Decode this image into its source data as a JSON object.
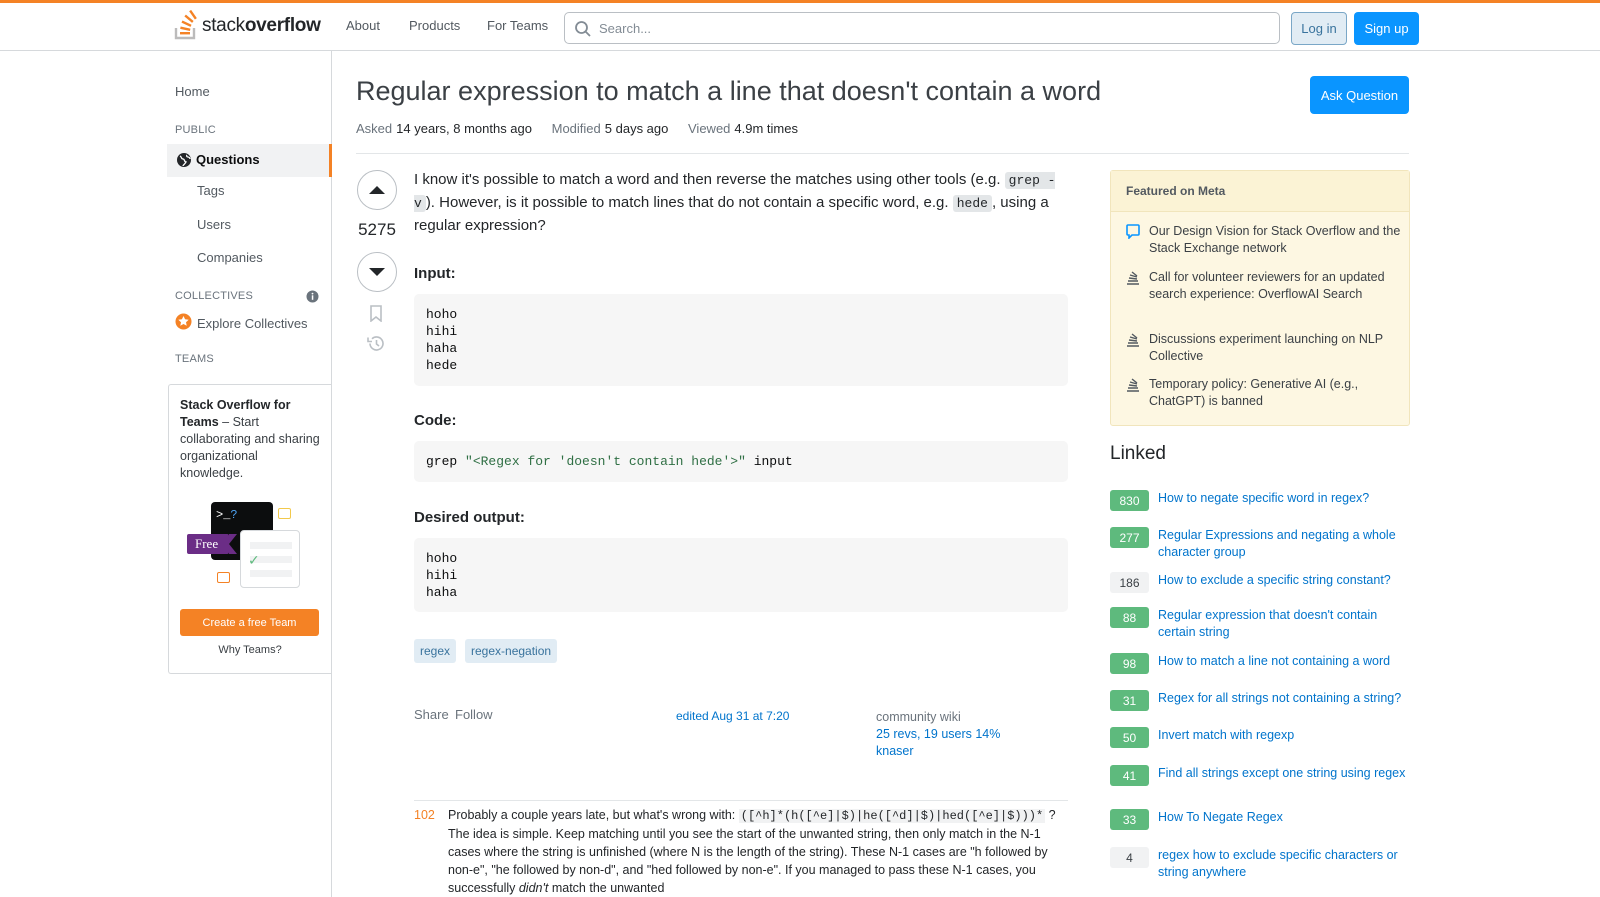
{
  "header": {
    "logo_light": "stack",
    "logo_bold": "overflow",
    "nav": [
      "About",
      "Products",
      "For Teams"
    ],
    "search_placeholder": "Search...",
    "login": "Log in",
    "signup": "Sign up"
  },
  "sidebar": {
    "home": "Home",
    "public_head": "PUBLIC",
    "questions": "Questions",
    "tags": "Tags",
    "users": "Users",
    "companies": "Companies",
    "collectives_head": "COLLECTIVES",
    "explore_collectives": "Explore Collectives",
    "teams_head": "TEAMS",
    "teams_title": "Stack Overflow for Teams",
    "teams_desc": "– Start collaborating and sharing organizational knowledge.",
    "free_badge": "Free",
    "create_team": "Create a free Team",
    "why_teams": "Why Teams?"
  },
  "question": {
    "title": "Regular expression to match a line that doesn't contain a word",
    "ask_button": "Ask Question",
    "asked_label": "Asked",
    "asked_value": "14 years, 8 months ago",
    "modified_label": "Modified",
    "modified_value": "5 days ago",
    "viewed_label": "Viewed",
    "viewed_value": "4.9m times",
    "votes": "5275",
    "body_1": "I know it's possible to match a word and then reverse the matches using other tools (e.g. ",
    "code_grep": "grep -v",
    "body_2": "). However, is it possible to match lines that do not contain a specific word, e.g. ",
    "code_hede": "hede",
    "body_3": ", using a regular expression?",
    "input_head": "Input:",
    "input_lines": [
      "hoho",
      "hihi",
      "haha",
      "hede"
    ],
    "code_head": "Code:",
    "code_cmd": "grep",
    "code_str": "\"<Regex for 'doesn't contain hede'>\"",
    "code_arg": "input",
    "output_head": "Desired output:",
    "output_lines": [
      "hoho",
      "hihi",
      "haha"
    ],
    "tags": [
      "regex",
      "regex-negation"
    ],
    "share": "Share",
    "follow": "Follow",
    "edited": "edited Aug 31 at 7:20",
    "wiki_label": "community wiki",
    "wiki_revs": "25 revs, 19 users 14%",
    "wiki_user": "knaser"
  },
  "comment": {
    "score": "102",
    "text_1": "Probably a couple years late, but what's wrong with: ",
    "code": "([^h]*(h([^e]|$)|he([^d]|$)|hed([^e]|$)))*",
    "text_2": " ? The idea is simple. Keep matching until you see the start of the unwanted string, then only match in the N-1 cases where the string is unfinished (where N is the length of the string). These N-1 cases are \"h followed by non-e\", \"he followed by non-d\", and \"hed followed by non-e\". If you managed to pass these N-1 cases, you successfully ",
    "em": "didn't",
    "text_3": " match the unwanted"
  },
  "featured": {
    "head": "Featured on Meta",
    "items": [
      "Our Design Vision for Stack Overflow and the Stack Exchange network",
      "Call for volunteer reviewers for an updated search experience: OverflowAI Search",
      "Discussions experiment launching on NLP Collective",
      "Temporary policy: Generative AI (e.g., ChatGPT) is banned"
    ]
  },
  "linked": {
    "head": "Linked",
    "items": [
      {
        "score": "830",
        "title": "How to negate specific word in regex?",
        "accepted": true
      },
      {
        "score": "277",
        "title": "Regular Expressions and negating a whole character group",
        "accepted": true
      },
      {
        "score": "186",
        "title": "How to exclude a specific string constant?",
        "accepted": false
      },
      {
        "score": "88",
        "title": "Regular expression that doesn't contain certain string",
        "accepted": true
      },
      {
        "score": "98",
        "title": "How to match a line not containing a word",
        "accepted": true
      },
      {
        "score": "31",
        "title": "Regex for all strings not containing a string?",
        "accepted": true
      },
      {
        "score": "50",
        "title": "Invert match with regexp",
        "accepted": true
      },
      {
        "score": "41",
        "title": "Find all strings except one string using regex",
        "accepted": true
      },
      {
        "score": "33",
        "title": "How To Negate Regex",
        "accepted": true
      },
      {
        "score": "4",
        "title": "regex how to exclude specific characters or string anywhere",
        "accepted": false
      }
    ]
  },
  "colors": {
    "accent": "#f48225",
    "primary": "#0a95ff",
    "link": "#0074cc",
    "accepted": "#5eba7d"
  }
}
